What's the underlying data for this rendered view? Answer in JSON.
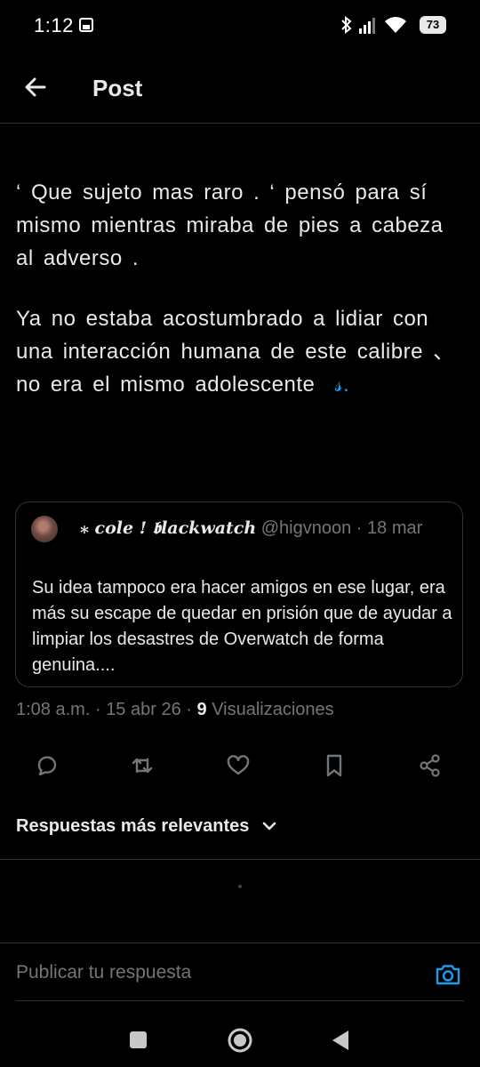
{
  "status_bar": {
    "time": "1:12",
    "battery": "73"
  },
  "header": {
    "title": "Post"
  },
  "post": {
    "paragraph1": "‘ Que sujeto mas raro . ‘  pensó para sí mismo mientras miraba de pies a cabeza al adverso .",
    "paragraph2": "Ya no estaba acostumbrado a lidiar con una interacción humana de este calibre 、no era el mismo adolescente",
    "paragraph2_link": "𝓈."
  },
  "quote": {
    "display_name": "⁎ cole ! 𝖇lackwatch",
    "handle": "@higvnoon",
    "separator": "·",
    "date": "18 mar",
    "text": "Su idea tampoco era hacer amigos en ese lugar, era más su escape de quedar en prisión que de ayudar a limpiar los desastres de Overwatch de forma genuina...."
  },
  "meta": {
    "time": "1:08 a.m.",
    "separator": "·",
    "date": "15 abr 26",
    "views_count": "9",
    "views_label": "Visualizaciones"
  },
  "actions": [
    "reply-icon",
    "retweet-icon",
    "like-icon",
    "bookmark-icon",
    "share-icon"
  ],
  "replies": {
    "sort_label": "Respuestas más relevantes"
  },
  "reply_box": {
    "placeholder": "Publicar tu respuesta"
  },
  "colors": {
    "background": "#000000",
    "text": "#e7e9ea",
    "secondary": "#71767b",
    "accent": "#1d9bf0",
    "border": "#2f3336"
  }
}
